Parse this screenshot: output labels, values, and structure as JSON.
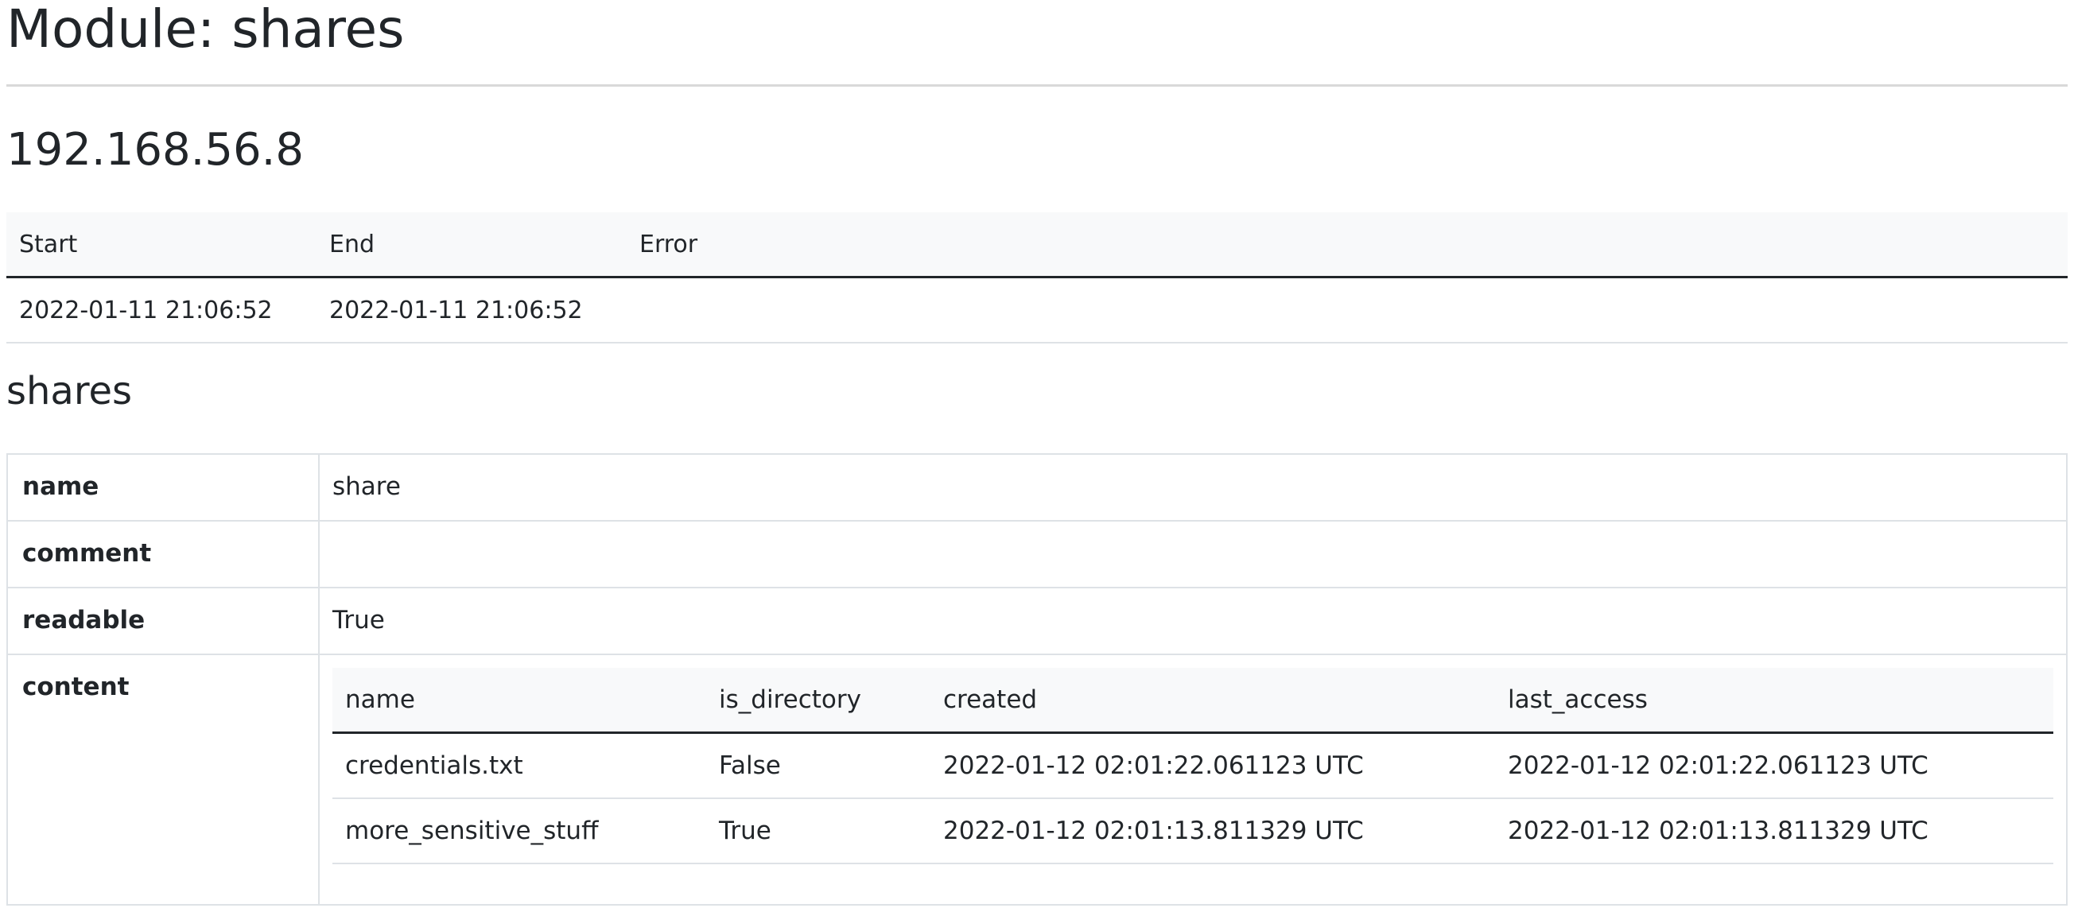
{
  "module_title": "Module: shares",
  "host": "192.168.56.8",
  "run": {
    "headers": [
      "Start",
      "End",
      "Error"
    ],
    "row": {
      "start": "2022-01-11 21:06:52",
      "end": "2022-01-11 21:06:52",
      "error": ""
    }
  },
  "section_title": "shares",
  "share": {
    "labels": {
      "name": "name",
      "comment": "comment",
      "readable": "readable",
      "content": "content"
    },
    "name": "share",
    "comment": "",
    "readable": "True",
    "content": {
      "headers": [
        "name",
        "is_directory",
        "created",
        "last_access"
      ],
      "rows": [
        {
          "name": "credentials.txt",
          "is_directory": "False",
          "created": "2022-01-12 02:01:22.061123 UTC",
          "last_access": "2022-01-12 02:01:22.061123 UTC"
        },
        {
          "name": "more_sensitive_stuff",
          "is_directory": "True",
          "created": "2022-01-12 02:01:13.811329 UTC",
          "last_access": "2022-01-12 02:01:13.811329 UTC"
        }
      ]
    }
  }
}
